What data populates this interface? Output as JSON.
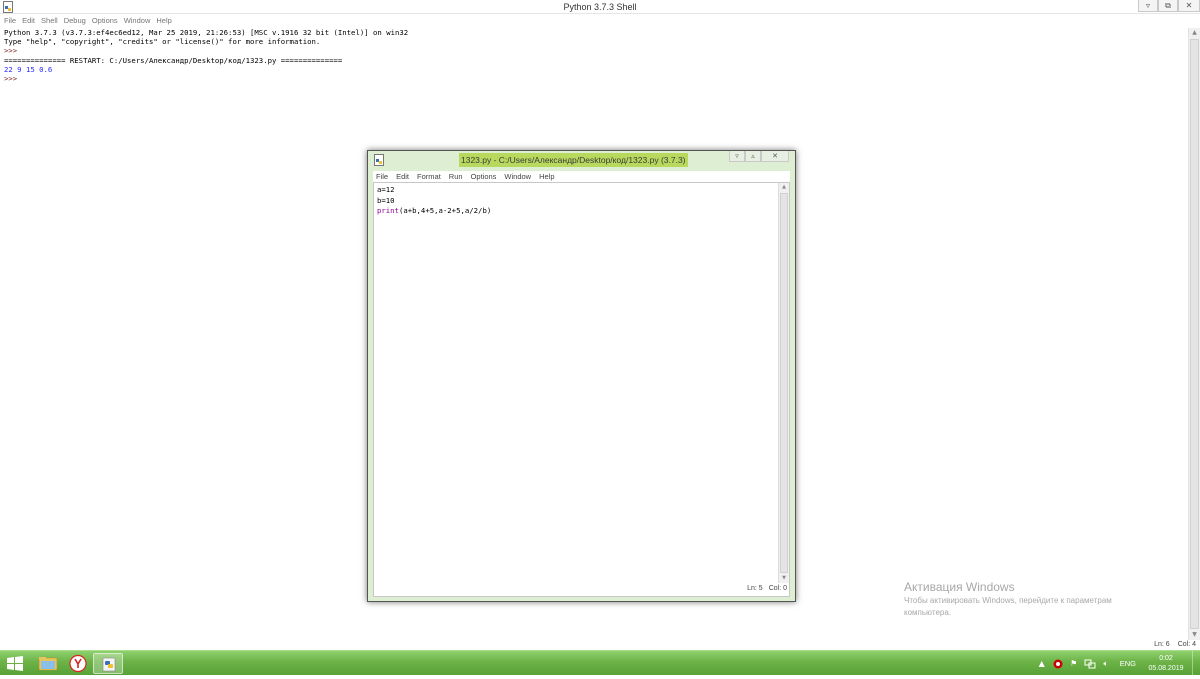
{
  "shell": {
    "title": "Python 3.7.3 Shell",
    "menu": [
      "File",
      "Edit",
      "Shell",
      "Debug",
      "Options",
      "Window",
      "Help"
    ],
    "lines": {
      "banner1": "Python 3.7.3 (v3.7.3:ef4ec6ed12, Mar 25 2019, 21:26:53) [MSC v.1916 32 bit (Intel)] on win32",
      "banner2": "Type \"help\", \"copyright\", \"credits\" or \"license()\" for more information.",
      "prompt1": ">>> ",
      "restart": "============== RESTART: C:/Users/Александр/Desktop/код/1323.py ==============",
      "output": "22 9 15 0.6",
      "prompt2": ">>> "
    },
    "status": {
      "line": "Ln: 6",
      "col": "Col: 4"
    }
  },
  "editor": {
    "title": "1323.py - C:/Users/Александр/Desktop/код/1323.py (3.7.3)",
    "menu": [
      "File",
      "Edit",
      "Format",
      "Run",
      "Options",
      "Window",
      "Help"
    ],
    "code": {
      "line1": "a=12",
      "line2": "b=10",
      "line3_builtin": "print",
      "line3_rest": "(a+b,4+5,a-2+5,a/2/b)"
    },
    "status": {
      "line": "Ln: 5",
      "col": "Col: 0"
    }
  },
  "activation": {
    "title": "Активация Windows",
    "text": "Чтобы активировать Windows, перейдите к параметрам компьютера."
  },
  "taskbar": {
    "language": "ENG",
    "time": "0:02",
    "date": "05.08.2019"
  },
  "colors": {
    "taskbar": "#6cb247",
    "editor_frame": "#ddeed3",
    "title_highlight": "#b7d95d",
    "stdout": "#2a2aff",
    "builtin": "#900090"
  }
}
